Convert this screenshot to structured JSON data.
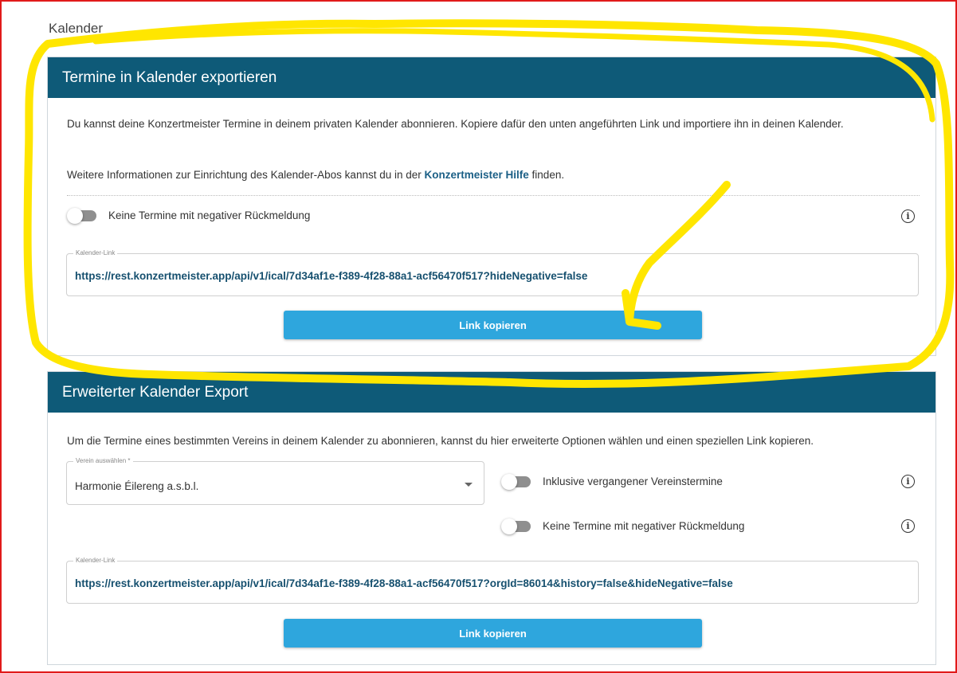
{
  "page": {
    "title": "Kalender"
  },
  "export_card": {
    "header": "Termine in Kalender exportieren",
    "description": "Du kannst deine Konzertmeister Termine in deinem privaten Kalender abonnieren. Kopiere dafür den unten angeführten Link und importiere ihn in deinen Kalender.",
    "info_prefix": "Weitere Informationen zur Einrichtung des Kalender-Abos kannst du in der ",
    "help_link": "Konzertmeister Hilfe",
    "info_suffix": " finden.",
    "toggle_label": "Keine Termine mit negativer Rückmeldung",
    "field_label": "Kalender-Link",
    "field_value": "https://rest.konzertmeister.app/api/v1/ical/7d34af1e-f389-4f28-88a1-acf56470f517?hideNegative=false",
    "button": "Link kopieren"
  },
  "extended_card": {
    "header": "Erweiterter Kalender Export",
    "description": "Um die Termine eines bestimmten Vereins in deinem Kalender zu abonnieren, kannst du hier erweiterte Optionen wählen und einen speziellen Link kopieren.",
    "select_label": "Verein auswählen *",
    "select_value": "Harmonie Éilereng a.s.b.l.",
    "toggle_history_label": "Inklusive vergangener Vereinstermine",
    "toggle_negative_label": "Keine Termine mit negativer Rückmeldung",
    "field_label": "Kalender-Link",
    "field_value": "https://rest.konzertmeister.app/api/v1/ical/7d34af1e-f389-4f28-88a1-acf56470f517?orgId=86014&history=false&hideNegative=false",
    "button": "Link kopieren"
  },
  "icons": {
    "info": "i"
  },
  "colors": {
    "header": "#0e5a78",
    "button": "#2ea6dd",
    "link": "#16506f",
    "annotation": "#ffe600",
    "frame": "#e11a1a"
  }
}
